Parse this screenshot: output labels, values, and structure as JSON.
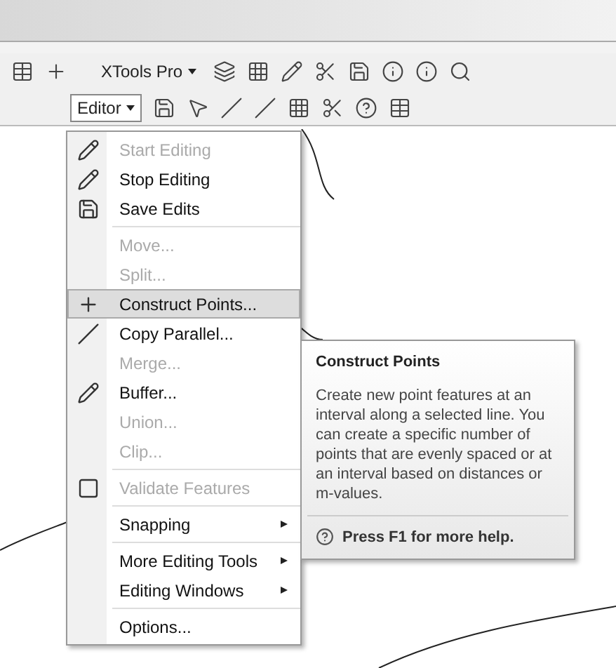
{
  "toolbar_top": {
    "dropdown": "XTools Pro"
  },
  "toolbar_editor": {
    "dropdown": "Editor"
  },
  "menu": [
    {
      "kind": "item",
      "label": "Start Editing",
      "disabled": true,
      "selected": false,
      "submenu": false
    },
    {
      "kind": "item",
      "label": "Stop Editing",
      "disabled": false,
      "selected": false,
      "submenu": false
    },
    {
      "kind": "item",
      "label": "Save Edits",
      "disabled": false,
      "selected": false,
      "submenu": false
    },
    {
      "kind": "separator"
    },
    {
      "kind": "item",
      "label": "Move...",
      "disabled": true,
      "selected": false,
      "submenu": false
    },
    {
      "kind": "item",
      "label": "Split...",
      "disabled": true,
      "selected": false,
      "submenu": false
    },
    {
      "kind": "item",
      "label": "Construct Points...",
      "disabled": false,
      "selected": true,
      "submenu": false
    },
    {
      "kind": "item",
      "label": "Copy Parallel...",
      "disabled": false,
      "selected": false,
      "submenu": false
    },
    {
      "kind": "item",
      "label": "Merge...",
      "disabled": true,
      "selected": false,
      "submenu": false
    },
    {
      "kind": "item",
      "label": "Buffer...",
      "disabled": false,
      "selected": false,
      "submenu": false
    },
    {
      "kind": "item",
      "label": "Union...",
      "disabled": true,
      "selected": false,
      "submenu": false
    },
    {
      "kind": "item",
      "label": "Clip...",
      "disabled": true,
      "selected": false,
      "submenu": false
    },
    {
      "kind": "separator"
    },
    {
      "kind": "item",
      "label": "Validate Features",
      "disabled": true,
      "selected": false,
      "submenu": false
    },
    {
      "kind": "separator"
    },
    {
      "kind": "item",
      "label": "Snapping",
      "disabled": false,
      "selected": false,
      "submenu": true
    },
    {
      "kind": "separator"
    },
    {
      "kind": "item",
      "label": "More Editing Tools",
      "disabled": false,
      "selected": false,
      "submenu": true
    },
    {
      "kind": "item",
      "label": "Editing Windows",
      "disabled": false,
      "selected": false,
      "submenu": true
    },
    {
      "kind": "separator"
    },
    {
      "kind": "item",
      "label": "Options...",
      "disabled": false,
      "selected": false,
      "submenu": false
    }
  ],
  "tooltip": {
    "title": "Construct Points",
    "body": "Create new point features at an interval along a selected line. You can create a specific number of points that are evenly spaced or at an interval based on distances or m-values.",
    "help": "Press F1 for more help."
  }
}
